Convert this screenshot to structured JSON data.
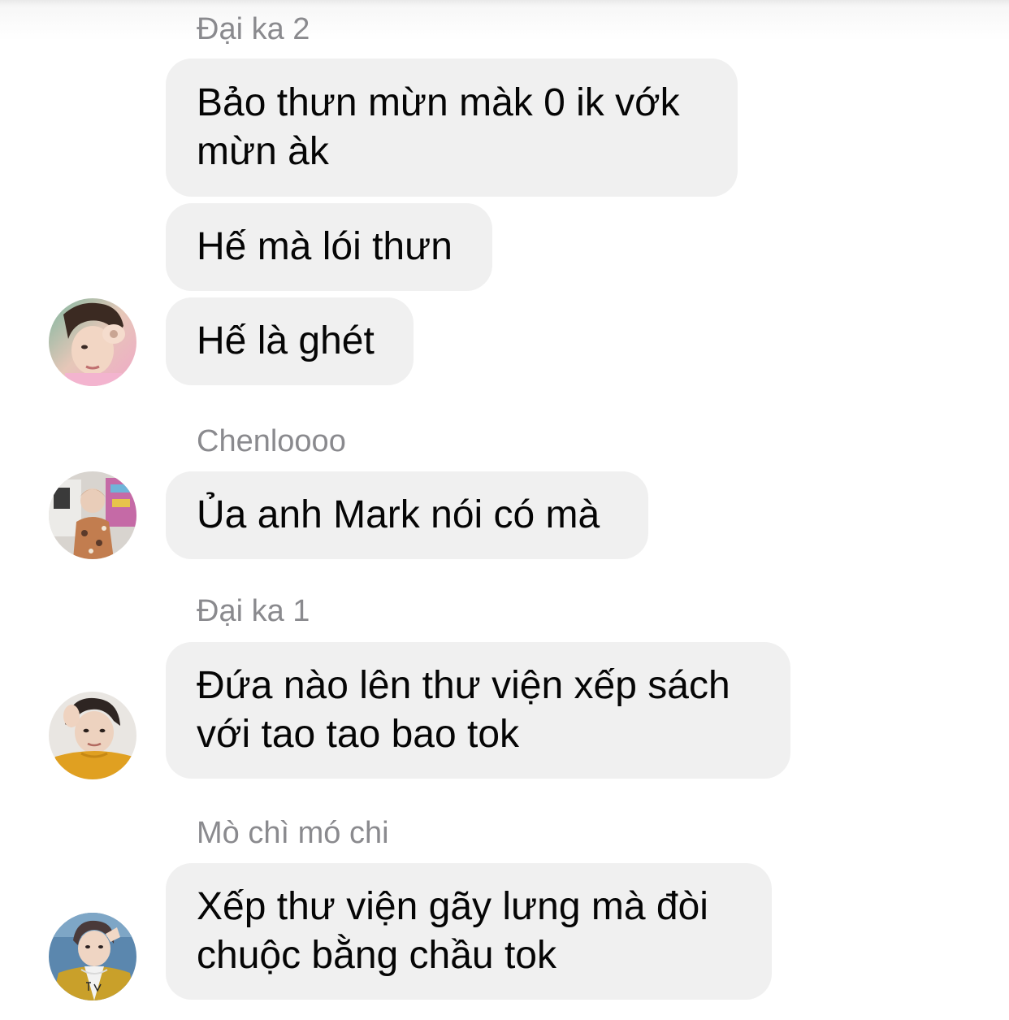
{
  "chat": {
    "groups": [
      {
        "sender": "Đại ka 2",
        "messages": [
          "Bảo thưn mừn màk 0 ik vớk mừn àk",
          "Hế mà lói thưn",
          "Hế là ghét"
        ]
      },
      {
        "sender": "Chenloooo",
        "messages": [
          "Ủa anh Mark nói có mà"
        ]
      },
      {
        "sender": "Đại ka 1",
        "messages": [
          "Đứa nào lên thư viện xếp sách với tao tao bao tok"
        ]
      },
      {
        "sender": "Mò chì mó chi",
        "messages": [
          "Xếp thư viện gãy lưng mà đòi chuộc bằng chầu tok"
        ]
      }
    ]
  },
  "colors": {
    "bubble": "#f0f0f0",
    "sender_name": "#8a8a8e",
    "message_text": "#050505"
  }
}
